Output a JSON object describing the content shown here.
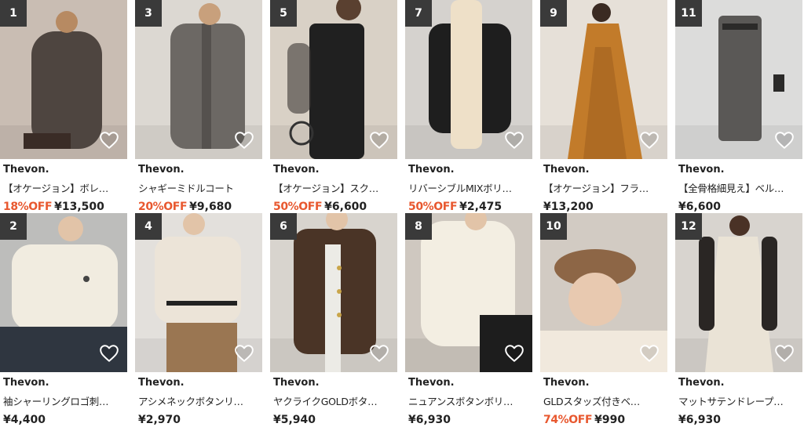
{
  "products": [
    {
      "rank": "1",
      "brand": "Thevon.",
      "name": "【オケージョン】ボレ…",
      "discount": "18%OFF",
      "price": "¥13,500",
      "palette": {
        "bg": "#c9bdb3",
        "main": "#4e4540",
        "accent": "#d6c4b4"
      }
    },
    {
      "rank": "3",
      "brand": "Thevon.",
      "name": "シャギーミドルコート",
      "discount": "20%OFF",
      "price": "¥9,680",
      "palette": {
        "bg": "#dcd8d2",
        "main": "#6c6864",
        "accent": "#3d3a37"
      }
    },
    {
      "rank": "5",
      "brand": "Thevon.",
      "name": "【オケージョン】スク…",
      "discount": "50%OFF",
      "price": "¥6,600",
      "palette": {
        "bg": "#d9d1c6",
        "main": "#202020",
        "accent": "#3a3633"
      }
    },
    {
      "rank": "7",
      "brand": "Thevon.",
      "name": "リバーシブルMIXボリ…",
      "discount": "50%OFF",
      "price": "¥2,475",
      "palette": {
        "bg": "#d5d2ce",
        "main": "#1e1e1e",
        "accent": "#eee0c8"
      }
    },
    {
      "rank": "9",
      "brand": "Thevon.",
      "name": "【オケージョン】フラ…",
      "discount": "",
      "price": "¥13,200",
      "palette": {
        "bg": "#e6e0d8",
        "main": "#c27b2a",
        "accent": "#8a4e18"
      }
    },
    {
      "rank": "11",
      "brand": "Thevon.",
      "name": "【全骨格細見え】ベル…",
      "discount": "",
      "price": "¥6,600",
      "palette": {
        "bg": "#dcdcdb",
        "main": "#5a5856",
        "accent": "#2b2a29"
      }
    },
    {
      "rank": "2",
      "brand": "Thevon.",
      "name": "袖シャーリングロゴ刺…",
      "discount": "",
      "price": "¥4,400",
      "palette": {
        "bg": "#bdbdbb",
        "main": "#f1ece0",
        "accent": "#2f3640"
      }
    },
    {
      "rank": "4",
      "brand": "Thevon.",
      "name": "アシメネックボタンリ…",
      "discount": "",
      "price": "¥2,970",
      "palette": {
        "bg": "#e3e0dc",
        "main": "#ece4d8",
        "accent": "#9a7652"
      }
    },
    {
      "rank": "6",
      "brand": "Thevon.",
      "name": "ヤクライクGOLDボタ…",
      "discount": "",
      "price": "¥5,940",
      "palette": {
        "bg": "#d8d4ce",
        "main": "#4a3426",
        "accent": "#ecebe6"
      }
    },
    {
      "rank": "8",
      "brand": "Thevon.",
      "name": "ニュアンスボタンボリ…",
      "discount": "",
      "price": "¥6,930",
      "palette": {
        "bg": "#cfc8c0",
        "main": "#f3eee2",
        "accent": "#1d1d1d"
      }
    },
    {
      "rank": "10",
      "brand": "Thevon.",
      "name": "GLDスタッズ付きベ…",
      "discount": "74%OFF",
      "price": "¥990",
      "palette": {
        "bg": "#d2cbc3",
        "main": "#8d6646",
        "accent": "#f1e9dd"
      }
    },
    {
      "rank": "12",
      "brand": "Thevon.",
      "name": "マットサテンドレープ…",
      "discount": "",
      "price": "¥6,930",
      "palette": {
        "bg": "#d8d4cf",
        "main": "#eae3d6",
        "accent": "#2a2624"
      }
    }
  ]
}
